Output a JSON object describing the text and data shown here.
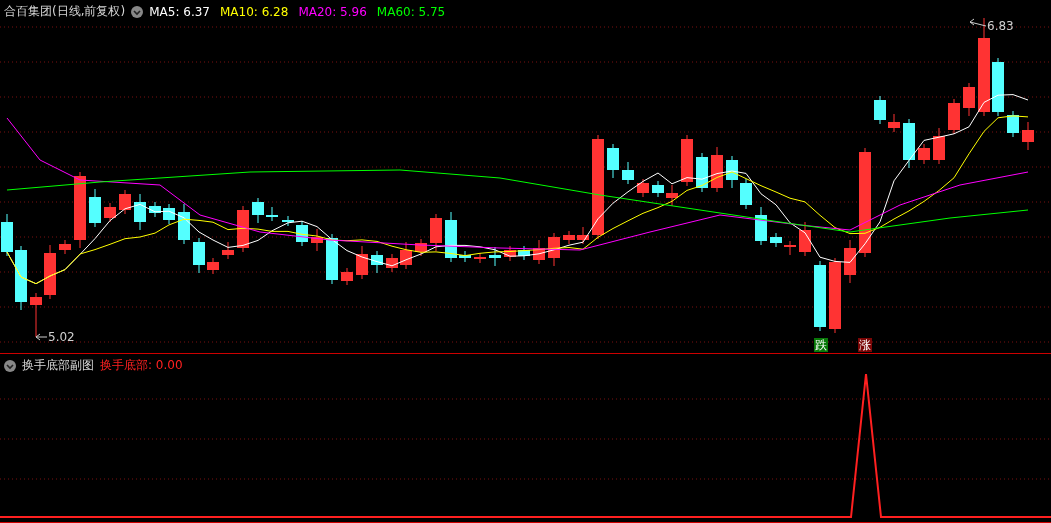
{
  "main_pane": {
    "title": "合百集团(日线,前复权)",
    "indicators": [
      {
        "label": "MA5: 6.37",
        "color": "#ffffff"
      },
      {
        "label": "MA10: 6.28",
        "color": "#ffff00"
      },
      {
        "label": "MA20: 5.96",
        "color": "#ff00ff"
      },
      {
        "label": "MA60: 5.75",
        "color": "#00ff00"
      }
    ],
    "price_labels": [
      {
        "kind": "high",
        "text": "6.83"
      },
      {
        "kind": "low",
        "text": "5.02"
      }
    ],
    "signals": [
      {
        "text": "跌",
        "color": "#087808"
      },
      {
        "text": "涨",
        "color": "#7a0606"
      }
    ]
  },
  "sub_pane": {
    "title": "换手底部副图",
    "indicator": {
      "label": "换手底部: 0.00",
      "color": "#ff2020"
    }
  }
}
